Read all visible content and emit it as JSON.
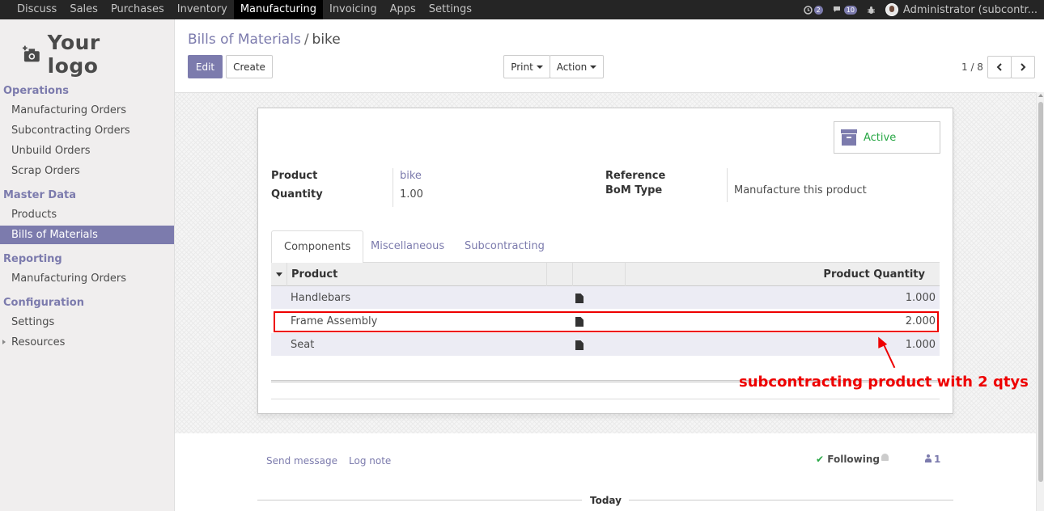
{
  "topnav": {
    "items": [
      {
        "label": "Discuss"
      },
      {
        "label": "Sales"
      },
      {
        "label": "Purchases"
      },
      {
        "label": "Inventory"
      },
      {
        "label": "Manufacturing",
        "active": true
      },
      {
        "label": "Invoicing"
      },
      {
        "label": "Apps"
      },
      {
        "label": "Settings"
      }
    ],
    "activity_badge": "2",
    "messages_badge": "10",
    "user": "Administrator (subcontr..."
  },
  "sidebar": {
    "logo_text": "Your logo",
    "sections": [
      {
        "title": "Operations",
        "items": [
          "Manufacturing Orders",
          "Subcontracting Orders",
          "Unbuild Orders",
          "Scrap Orders"
        ]
      },
      {
        "title": "Master Data",
        "items": [
          "Products",
          "Bills of Materials"
        ]
      },
      {
        "title": "Reporting",
        "items": [
          "Manufacturing Orders"
        ]
      },
      {
        "title": "Configuration",
        "items": [
          "Settings",
          "Resources"
        ]
      }
    ],
    "active_item": "Bills of Materials"
  },
  "breadcrumb": {
    "parent": "Bills of Materials",
    "separator": "/",
    "current": "bike"
  },
  "buttons": {
    "edit": "Edit",
    "create": "Create",
    "print": "Print",
    "action": "Action"
  },
  "pager": {
    "value": "1 / 8"
  },
  "form": {
    "status": "Active",
    "product_label": "Product",
    "product_value": "bike",
    "quantity_label": "Quantity",
    "quantity_value": "1.00",
    "reference_label": "Reference",
    "bom_type_label": "BoM Type",
    "bom_type_value": "Manufacture this product"
  },
  "tabs": [
    "Components",
    "Miscellaneous",
    "Subcontracting"
  ],
  "table": {
    "headers": {
      "product": "Product",
      "quantity": "Product Quantity"
    },
    "rows": [
      {
        "product": "Handlebars",
        "quantity": "1.000"
      },
      {
        "product": "Frame Assembly",
        "quantity": "2.000"
      },
      {
        "product": "Seat",
        "quantity": "1.000"
      }
    ]
  },
  "annotation": "subcontracting product with 2 qtys",
  "chatter": {
    "send_message": "Send message",
    "log_note": "Log note",
    "following": "Following",
    "followers": "1",
    "today": "Today"
  },
  "colors": {
    "brand": "#7c7bad",
    "active_status": "#28a745",
    "annotation": "#e00000",
    "topbar": "#252525"
  }
}
